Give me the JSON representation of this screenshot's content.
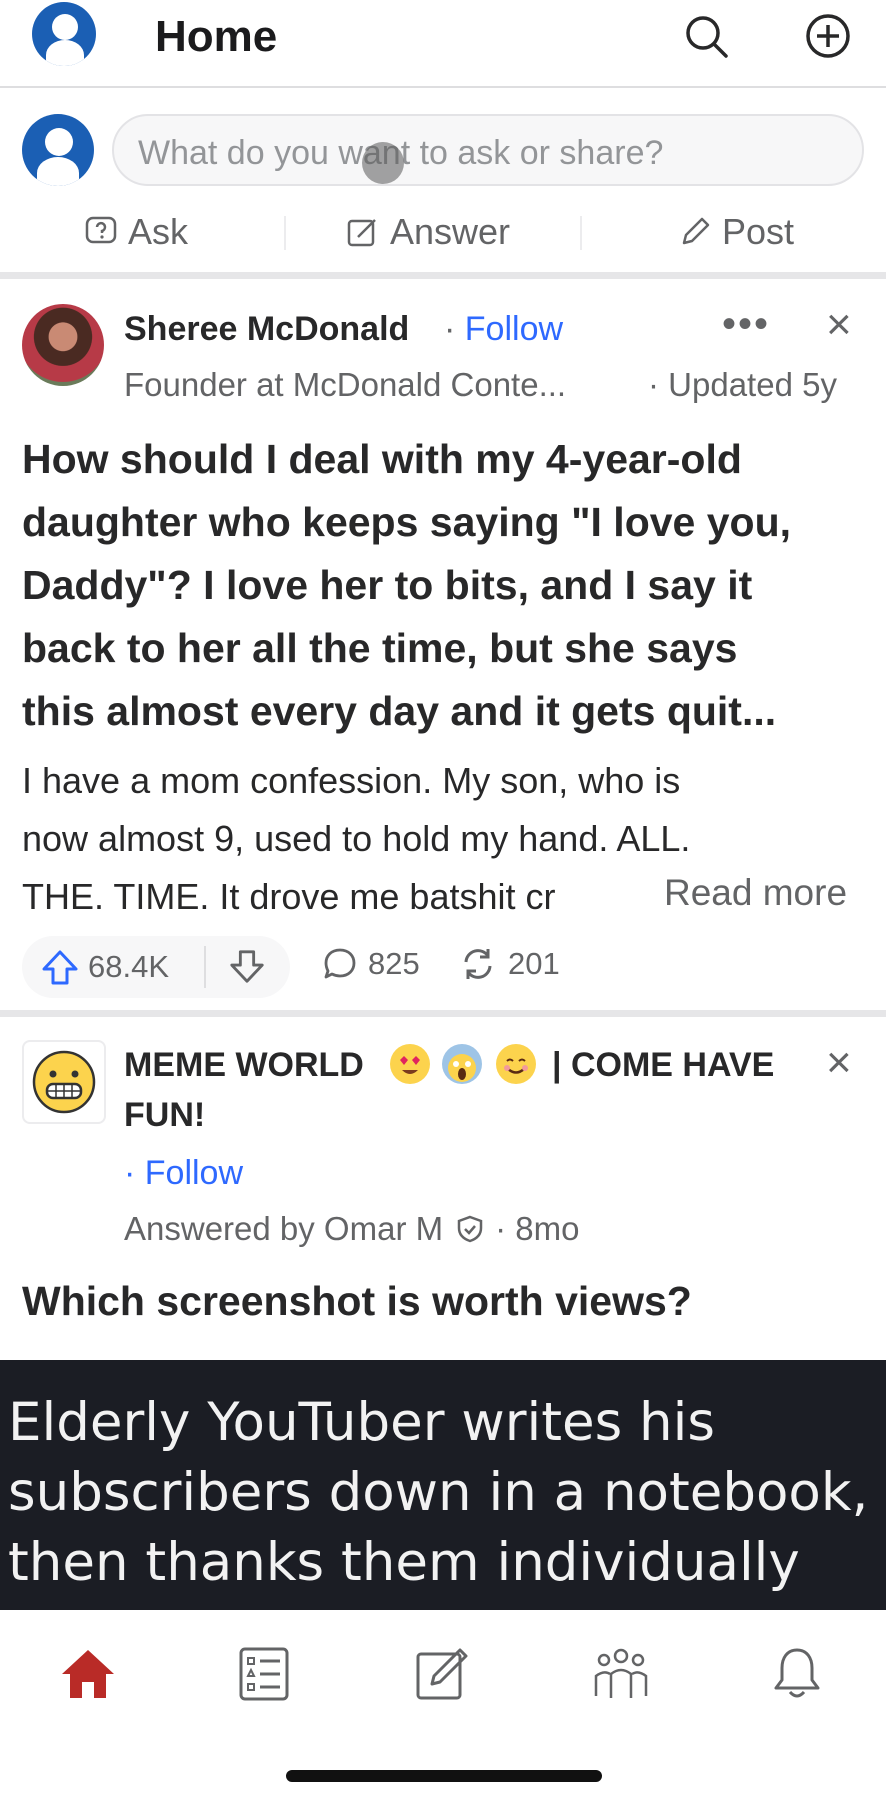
{
  "header": {
    "title": "Home",
    "icons": [
      "profile-avatar-icon",
      "search-icon",
      "add-circle-icon"
    ]
  },
  "composer": {
    "placeholder": "What do you want to ask or share?",
    "actions": [
      {
        "label": "Ask",
        "icon": "question-icon"
      },
      {
        "label": "Answer",
        "icon": "edit-icon"
      },
      {
        "label": "Post",
        "icon": "pencil-icon"
      }
    ]
  },
  "post1": {
    "author": "Sheree McDonald",
    "follow_label": "Follow",
    "credential": "Founder at McDonald Conte...",
    "updated": "· Updated 5y",
    "question": "How should I deal with my 4-year-old daughter who keeps saying \"I love you, Daddy\"? I love her to bits, and I say it back to her all the time, but she says this almost every day and it gets quit...",
    "q_lines": [
      "How should I deal with my 4-year-old",
      "daughter who keeps saying \"I love you,",
      "Daddy\"? I love her to bits, and I say it",
      "back to her all the time, but she says",
      "this almost every day and it gets quit..."
    ],
    "body_lines": [
      "I have a mom confession. My son, who is",
      "now almost 9, used to hold my hand. ALL.",
      "THE. TIME. It drove me batshit cr"
    ],
    "read_more": "Read more",
    "upvotes": "68.4K",
    "comments": "825",
    "shares": "201",
    "dots": "•••",
    "close": "×"
  },
  "post2": {
    "space_name_a": "MEME WORLD",
    "space_name_b": "| COME HAVE",
    "space_name_c": "FUN!",
    "follow_label": "· Follow",
    "answered_by": "Answered by Omar M",
    "age": "· 8mo",
    "question": "Which screenshot is worth views?",
    "close": "×",
    "image_lines": [
      "Elderly YouTuber writes his",
      "subscribers down in a notebook,",
      "then thanks them individually"
    ]
  },
  "colors": {
    "brand_red": "#b92b27",
    "link_blue": "#2e69ff",
    "avatar_blue": "#1b5fb4"
  },
  "bottom_nav": [
    "home-icon",
    "following-list-icon",
    "write-icon",
    "spaces-icon",
    "notifications-icon"
  ]
}
